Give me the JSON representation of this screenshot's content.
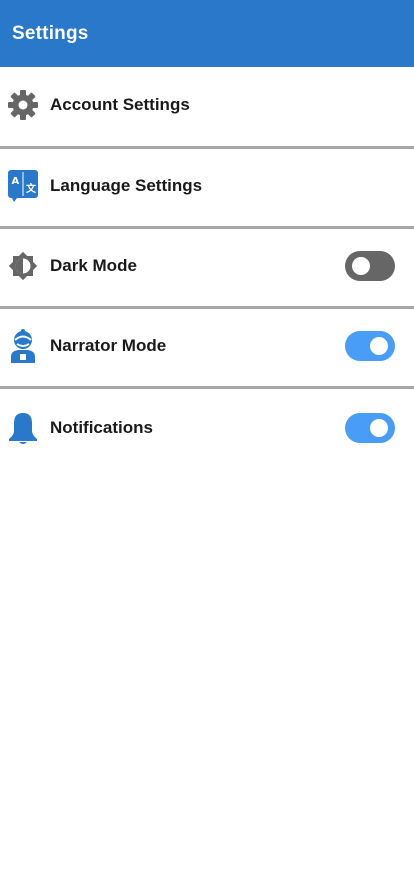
{
  "header": {
    "title": "Settings"
  },
  "colors": {
    "app_bar": "#2a78c9",
    "toggle_on": "#4a9df5",
    "toggle_off": "#666666",
    "divider": "#a7a7a7",
    "icon_gray": "#666666",
    "icon_blue": "#2a78c9"
  },
  "settings": {
    "items": [
      {
        "label": "Account Settings",
        "icon": "gear-icon"
      },
      {
        "label": "Language Settings",
        "icon": "translate-icon"
      },
      {
        "label": "Dark Mode",
        "icon": "brightness-icon",
        "toggle": "off"
      },
      {
        "label": "Narrator Mode",
        "icon": "narrator-icon",
        "toggle": "on"
      },
      {
        "label": "Notifications",
        "icon": "bell-icon",
        "toggle": "on"
      }
    ]
  }
}
